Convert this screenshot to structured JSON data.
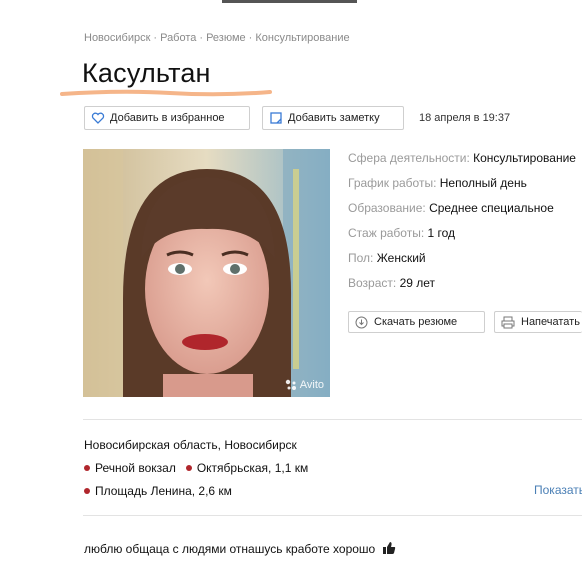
{
  "breadcrumbs": [
    "Новосибирск",
    "Работа",
    "Резюме",
    "Консультирование"
  ],
  "breadcrumb_sep": "·",
  "title": "Касультан",
  "actions": {
    "favorite_label": "Добавить в избранное",
    "note_label": "Добавить заметку"
  },
  "posted_date": "18 апреля в 19:37",
  "photo": {
    "watermark": "Avito"
  },
  "params": [
    {
      "label": "Сфера деятельности:",
      "value": "Консультирование"
    },
    {
      "label": "График работы:",
      "value": "Неполный день"
    },
    {
      "label": "Образование:",
      "value": "Среднее специальное"
    },
    {
      "label": "Стаж работы:",
      "value": "1 год"
    },
    {
      "label": "Пол:",
      "value": "Женский"
    },
    {
      "label": "Возраст:",
      "value": "29 лет"
    }
  ],
  "resume_actions": {
    "download_label": "Скачать резюме",
    "print_label": "Напечатать"
  },
  "location": {
    "address": "Новосибирская область, Новосибирск",
    "metro": [
      {
        "name": "Речной вокзал",
        "distance": ""
      },
      {
        "name": "Октябрьская",
        "distance": ", 1,1 км"
      },
      {
        "name": "Площадь Ленина",
        "distance": ", 2,6 км"
      }
    ],
    "show_map_label": "Показать"
  },
  "description": "люблю общаца с людями отнашусь кработе хорошо",
  "colors": {
    "metro_dot": "#b0262c",
    "link": "#4a7fb5",
    "underline": "#f2a36b"
  }
}
